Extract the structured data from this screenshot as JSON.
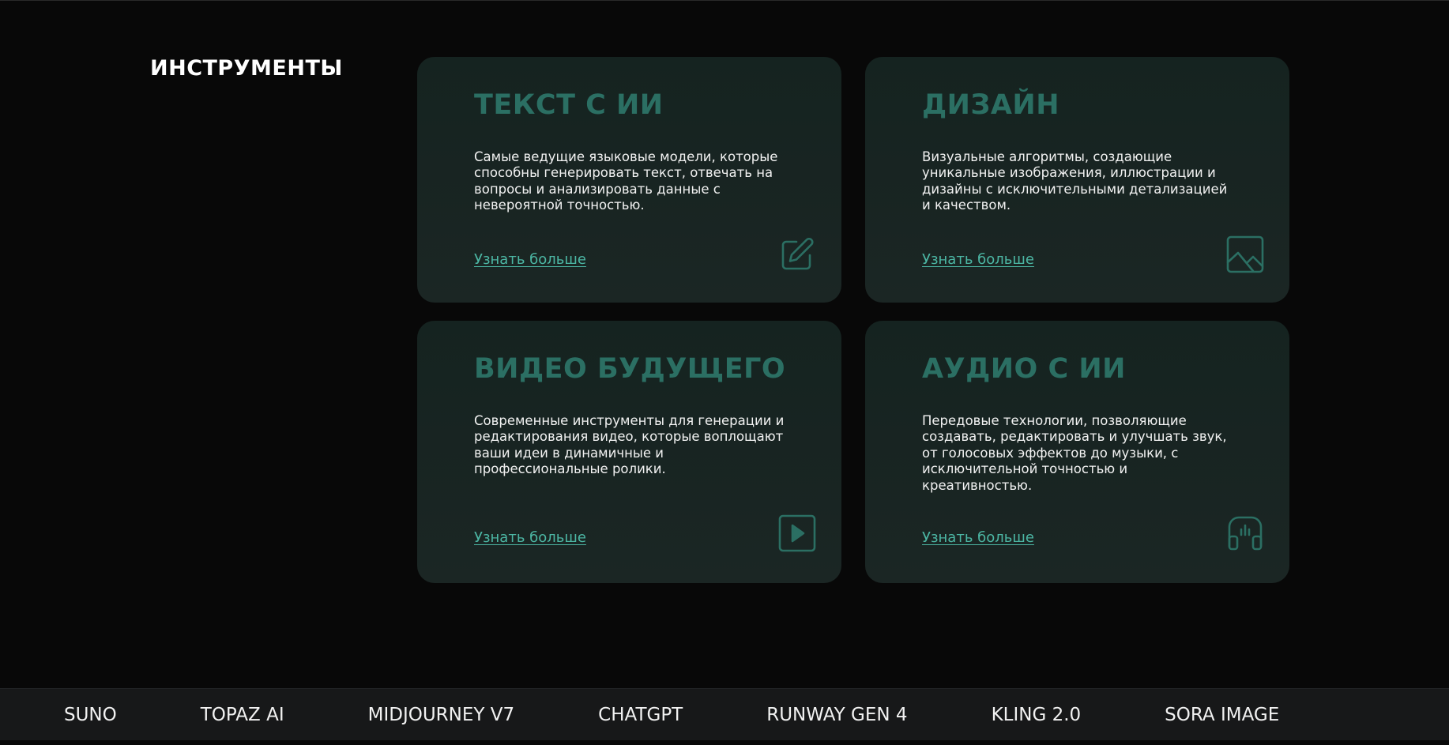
{
  "section": {
    "title": "ИНСТРУМЕНТЫ"
  },
  "cards": [
    {
      "title": "ТЕКСТ С ИИ",
      "description": "Самые ведущие языковые модели, которые способны генерировать текст, отвечать на вопросы и анализировать данные с невероятной точностью.",
      "link": "Узнать больше",
      "icon": "edit-icon"
    },
    {
      "title": "ДИЗАЙН",
      "description": "Визуальные алгоритмы, создающие уникальные изображения, иллюстрации и дизайны с исключительными детализацией и качеством.",
      "link": "Узнать больше",
      "icon": "image-icon"
    },
    {
      "title": "ВИДЕО БУДУЩЕГО",
      "description": "Современные инструменты для генерации и редактирования видео, которые воплощают ваши идеи в динамичные и профессиональные ролики.",
      "link": "Узнать больше",
      "icon": "play-icon"
    },
    {
      "title": "АУДИО С ИИ",
      "description": "Передовые технологии, позволяющие создавать, редактировать и улучшать звук, от голосовых эффектов до музыки, с исключительной точностью и креативностью.",
      "link": "Узнать больше",
      "icon": "headphones-icon"
    }
  ],
  "ticker": {
    "items": [
      "SUNO",
      "TOPAZ AI",
      "MIDJOURNEY V7",
      "CHATGPT",
      "RUNWAY GEN 4",
      "KLING 2.0",
      "SORA IMAGE"
    ]
  },
  "colors": {
    "background": "#080808",
    "card_background": "#172523",
    "accent_title": "#2b6f63",
    "link": "#4cb7a4",
    "ticker_background": "#171819"
  }
}
